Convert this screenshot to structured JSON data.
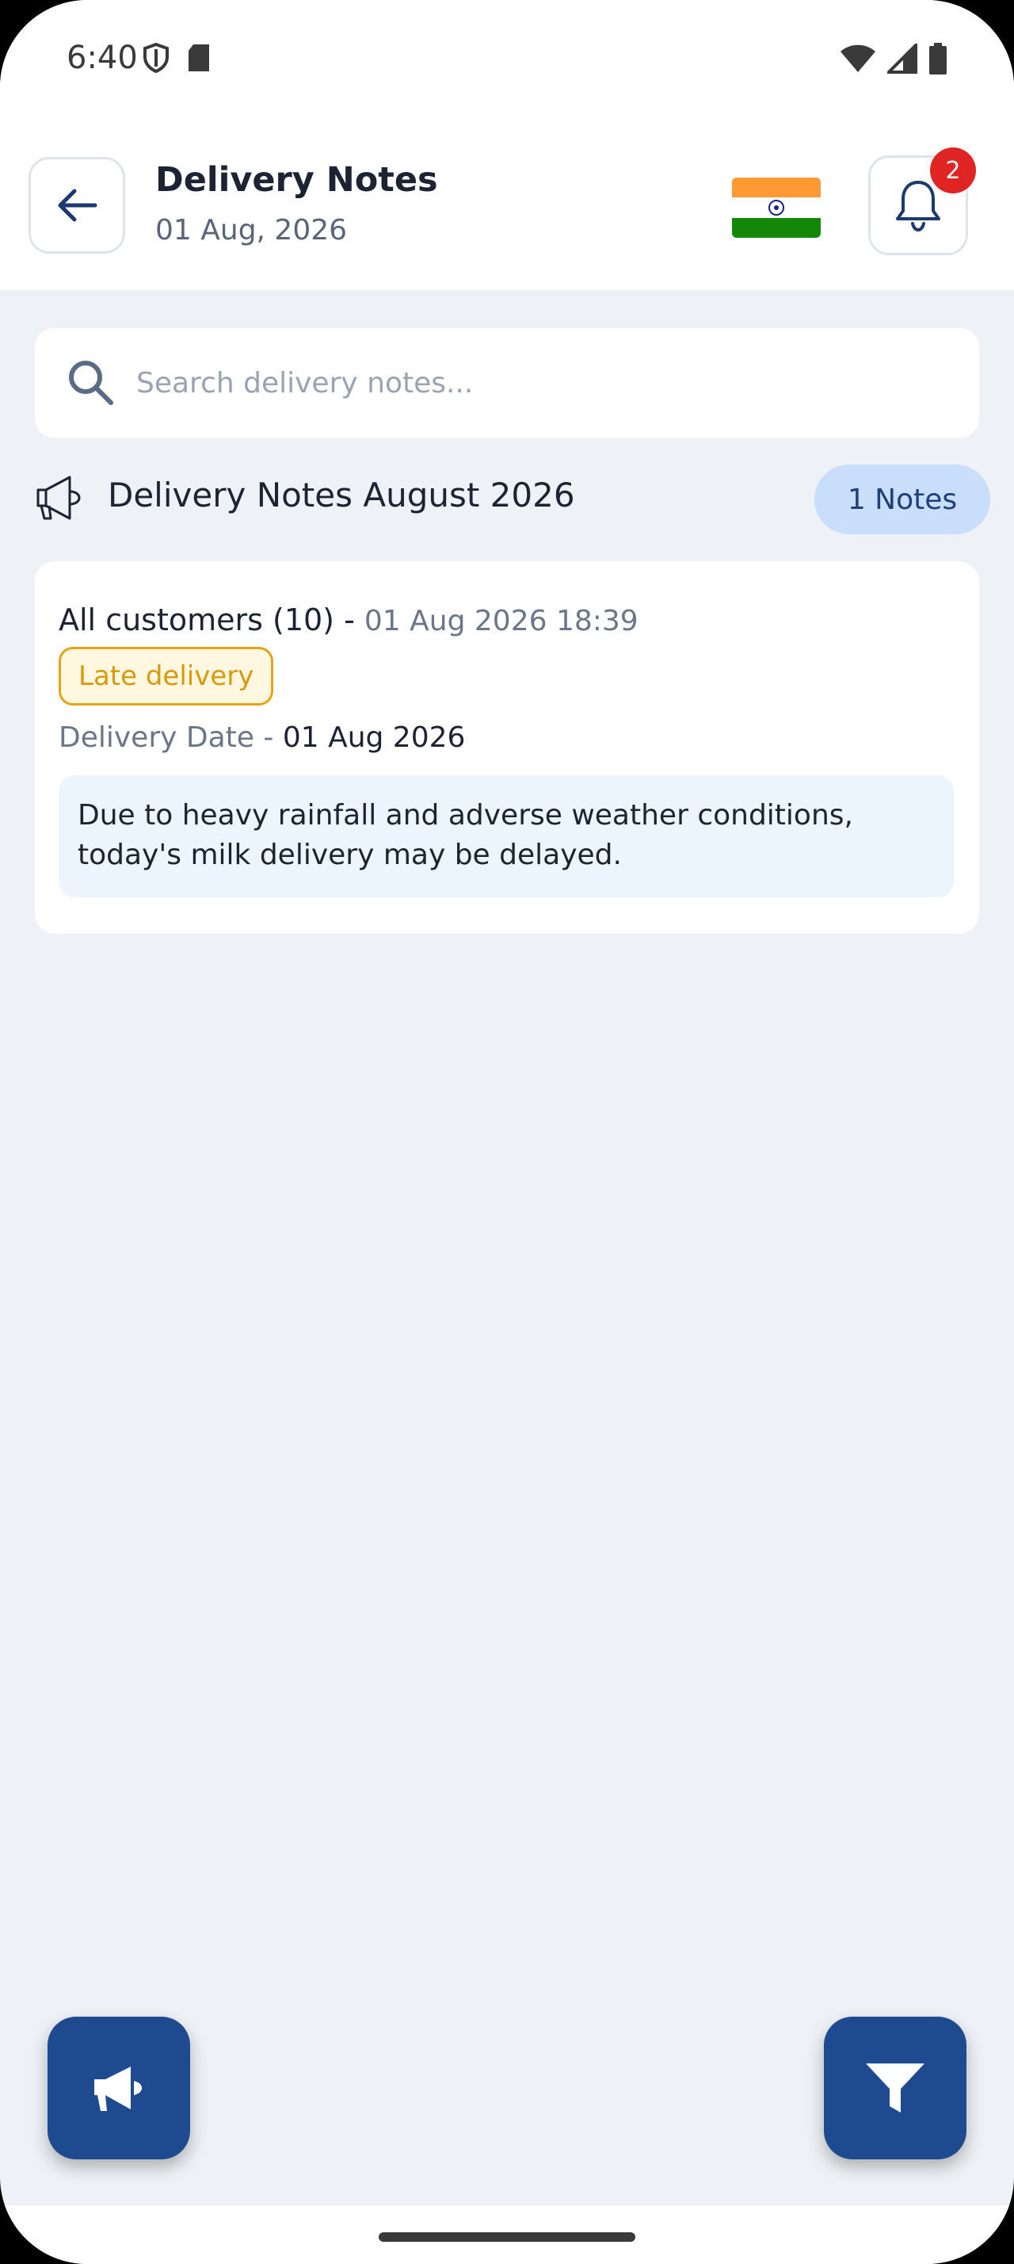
{
  "status_bar": {
    "time": "6:40",
    "left_icons": [
      "shield-icon",
      "sd-card-icon"
    ],
    "right_icons": [
      "wifi-icon",
      "signal-icon",
      "battery-icon"
    ]
  },
  "header": {
    "title": "Delivery Notes",
    "date": "01 Aug, 2026",
    "notification_count": "2",
    "flag": "india-flag"
  },
  "search": {
    "placeholder": "Search delivery notes...",
    "value": ""
  },
  "section": {
    "title": "Delivery Notes August 2026",
    "count_label": "1 Notes"
  },
  "notes": [
    {
      "audience": "All customers (10) -",
      "timestamp": "01 Aug 2026 18:39",
      "tag": "Late delivery",
      "delivery_label": "Delivery Date -",
      "delivery_date": "01 Aug 2026",
      "message": "Due to heavy rainfall and adverse weather conditions, today's milk delivery may be delayed."
    }
  ],
  "colors": {
    "primary": "#1e4a8f",
    "background": "#eef2f6",
    "badge": "#e02424",
    "tag_border": "#e6a313",
    "pill": "#c9defa"
  }
}
